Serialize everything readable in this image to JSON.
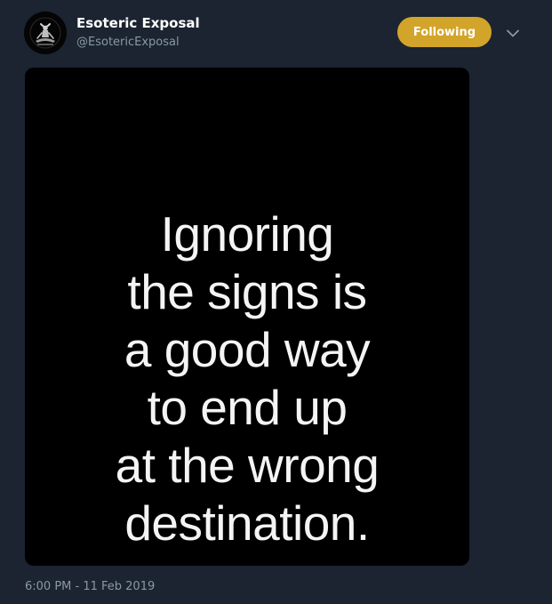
{
  "tweet": {
    "author": {
      "display_name": "Esoteric Exposal",
      "handle": "@EsotericExposal",
      "avatar_icon": "seated-figure-icon"
    },
    "follow_button": {
      "label": "Following",
      "color": "#d3a42a"
    },
    "menu_icon": "chevron-down-icon",
    "media": {
      "background": "#000000",
      "text_lines": [
        "Ignoring",
        "the signs is",
        "a good way",
        "to end up",
        "at the wrong",
        "destination."
      ]
    },
    "timestamp": "6:00 PM - 11 Feb 2019"
  },
  "colors": {
    "page_background": "#1b2430",
    "secondary_text": "#8899a6"
  }
}
